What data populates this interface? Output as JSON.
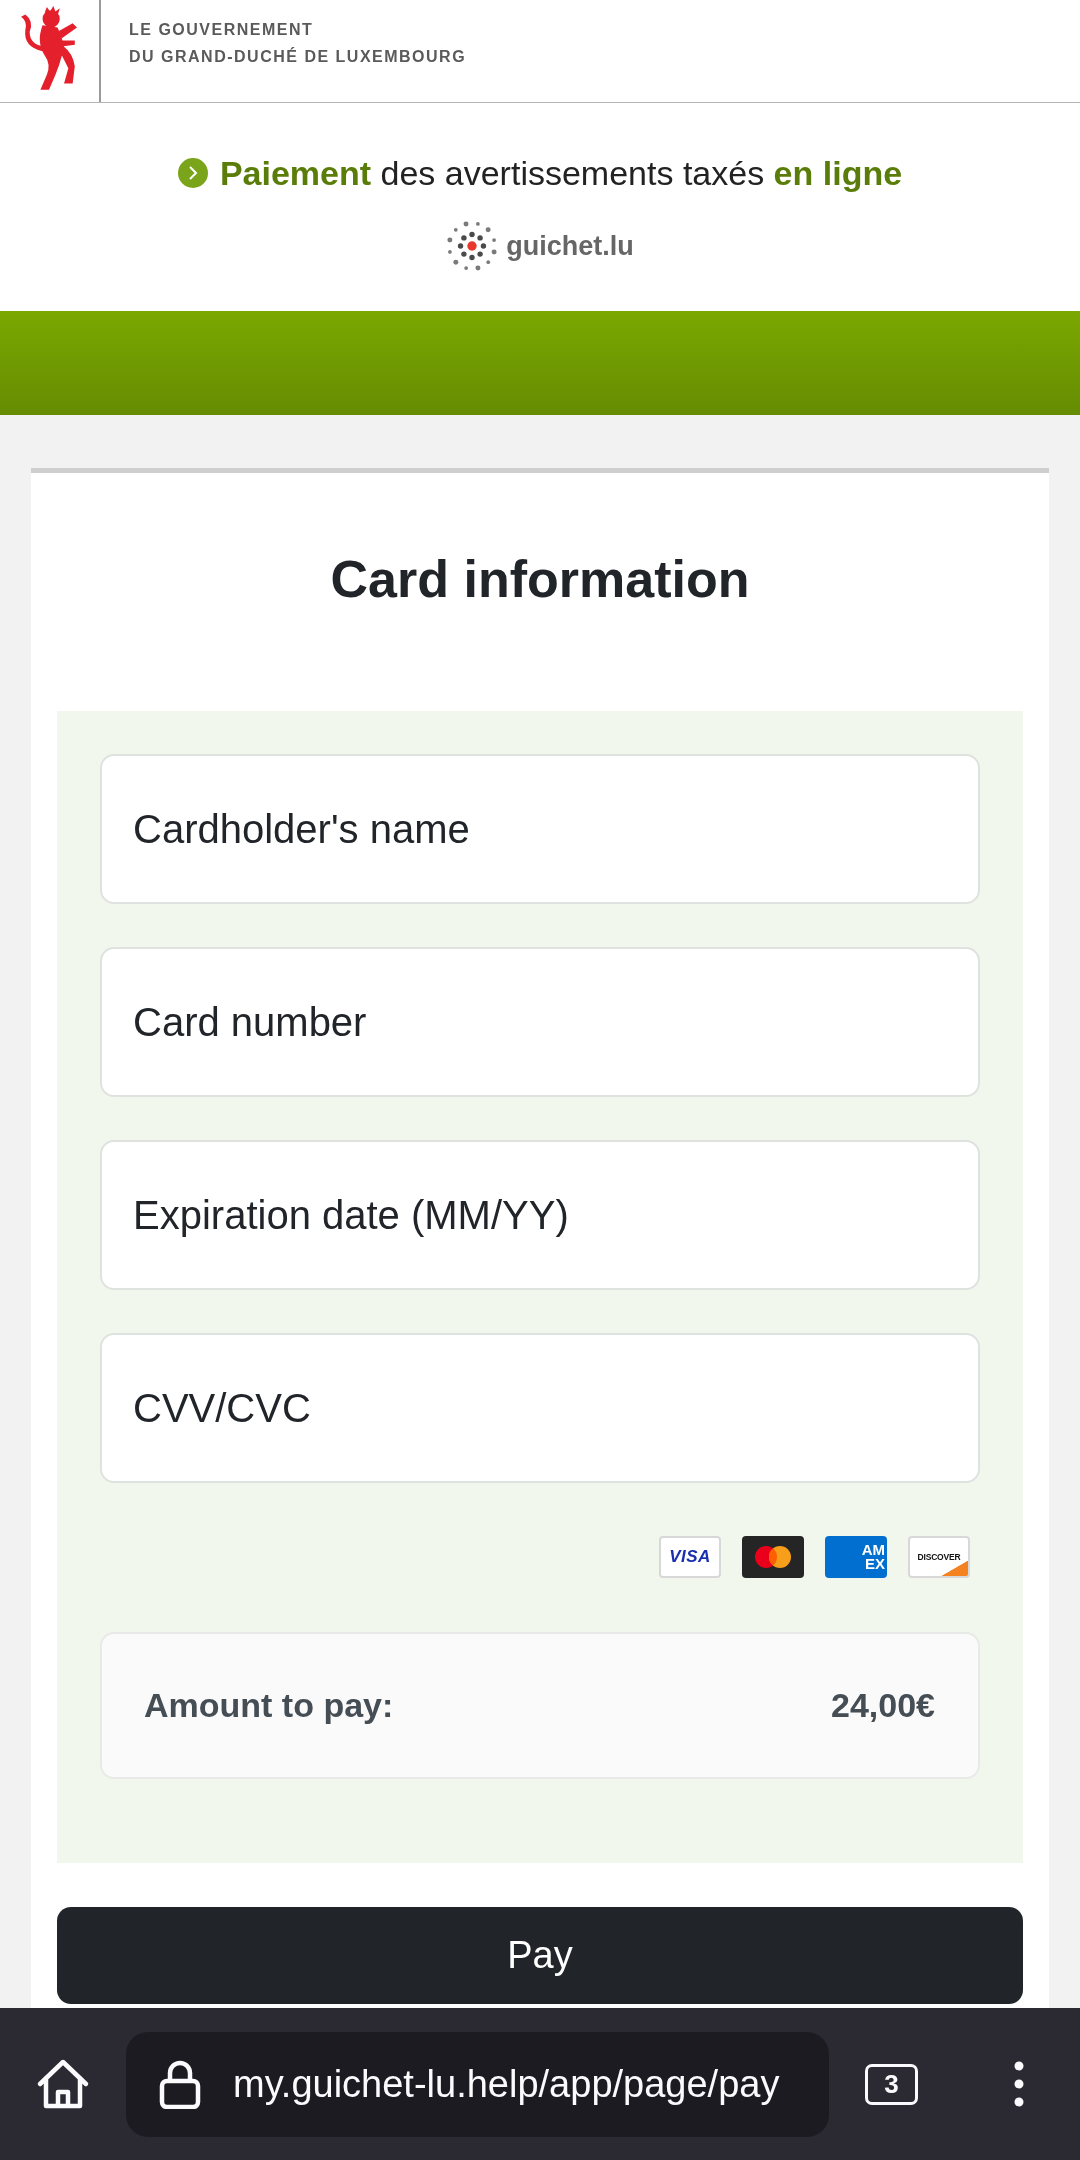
{
  "header": {
    "lines": [
      "LE GOUVERNEMENT",
      "DU GRAND-DUCHÉ DE LUXEMBOURG"
    ]
  },
  "banner": {
    "title": "**Paiement** des avertissements taxés **en ligne**",
    "brand": "guichet.lu"
  },
  "form": {
    "title": "Card information",
    "fields": [
      {
        "placeholder": "Cardholder's name"
      },
      {
        "placeholder": "Card number"
      },
      {
        "placeholder": "Expiration date (MM/YY)"
      },
      {
        "placeholder": "CVV/CVC"
      }
    ],
    "card_logos": [
      {
        "kind": "visa",
        "lines": [
          "VISA"
        ]
      },
      {
        "kind": "mastercard"
      },
      {
        "kind": "amex",
        "lines": [
          "AM",
          "EX"
        ]
      },
      {
        "kind": "discover",
        "lines": [
          "DISCOVER"
        ]
      }
    ],
    "amount": {
      "label": "Amount to pay:",
      "value": "24,00€"
    },
    "pay_button": "Pay"
  },
  "browser": {
    "url": "my.guichet-lu.help/app/page/pay",
    "tab_count": "3"
  }
}
